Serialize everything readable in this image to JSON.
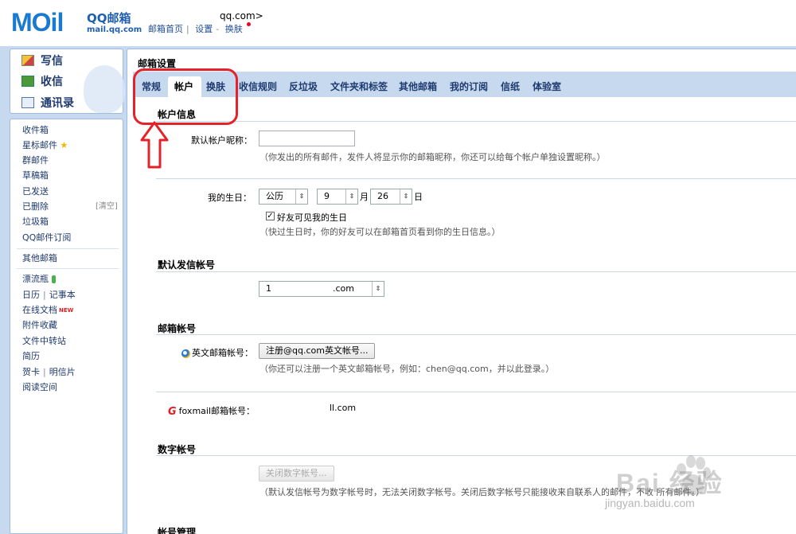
{
  "header": {
    "logo_main": "MOil",
    "logo_qq": "QQ邮箱",
    "logo_url": "mail.qq.com",
    "user_address": "qq.com>",
    "links": [
      "邮箱首页",
      "设置",
      "换肤"
    ]
  },
  "sidebar": {
    "actions": [
      {
        "label": "写信",
        "icon": "pencil-icon"
      },
      {
        "label": "收信",
        "icon": "inbox-download-icon"
      },
      {
        "label": "通讯录",
        "icon": "contacts-book-icon"
      }
    ],
    "folders": [
      "收件箱",
      "星标邮件",
      "群邮件",
      "草稿箱",
      "已发送",
      "已删除",
      "垃圾箱",
      "QQ邮件订阅"
    ],
    "clear_label": "[清空]",
    "other_mailbox": "其他邮箱",
    "apps": {
      "bottle": "漂流瓶",
      "calendar": "日历",
      "notebook": "记事本",
      "online_docs": "在线文档",
      "new_badge": "NEW",
      "attachments": "附件收藏",
      "file_transfer": "文件中转站",
      "resume": "简历",
      "greeting_card": "贺卡",
      "postcard": "明信片",
      "reading": "阅读空间"
    }
  },
  "main": {
    "title": "邮箱设置",
    "tabs": [
      "常规",
      "帐户",
      "换肤",
      "收信规则",
      "反垃圾",
      "文件夹和标签",
      "其他邮箱",
      "我的订阅",
      "信纸",
      "体验室"
    ],
    "active_tab": "帐户",
    "account_info": {
      "title": "帐户信息",
      "nickname_label": "默认帐户昵称：",
      "nickname_value": "",
      "nickname_hint": "（你发出的所有邮件，发件人将显示你的邮箱昵称，你还可以给每个帐户单独设置昵称。）",
      "birthday_label": "我的生日：",
      "calendar_type": "公历",
      "month": "9",
      "month_unit": "月",
      "day": "26",
      "day_unit": "日",
      "friends_visible_label": "好友可见我的生日",
      "friends_visible_checked": true,
      "birthday_hint": "（快过生日时，你的好友可以在邮箱首页看到你的生日信息。）"
    },
    "default_sender": {
      "title": "默认发信帐号",
      "value_prefix": "1",
      "value_suffix": ".com"
    },
    "mail_accounts": {
      "title": "邮箱帐号",
      "english_label": "英文邮箱帐号：",
      "english_button": "注册@qq.com英文帐号...",
      "english_hint": "（你还可以注册一个英文邮箱帐号，例如：chen@qq.com，并以此登录。）",
      "foxmail_label": "foxmail邮箱帐号：",
      "foxmail_value": "ll.com"
    },
    "numeric_account": {
      "title": "数字帐号",
      "close_button": "关闭数字帐号...",
      "hint": "（默认发信帐号为数字帐号时，无法关闭数字帐号。关闭后数字帐号只能接收来自联系人的邮件，不收                                                所有邮件。）"
    },
    "account_management": {
      "title": "帐号管理"
    }
  },
  "watermark": {
    "text": "Bai   经验",
    "url": "jingyan.baidu.com"
  },
  "colors": {
    "frame_blue": "#c6d9ee",
    "link_blue": "#1f3a6e",
    "annotation_red": "#e3222a"
  }
}
